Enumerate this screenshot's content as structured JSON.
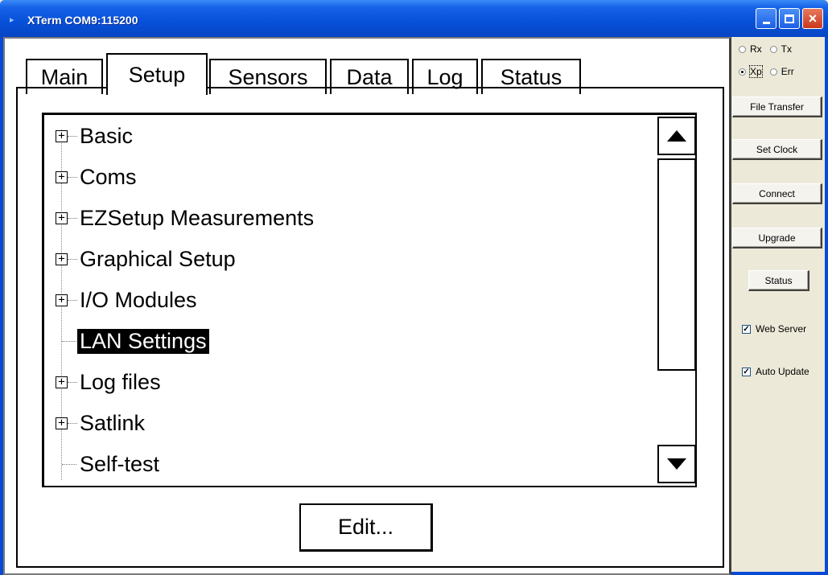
{
  "window": {
    "title": "XTerm COM9:115200"
  },
  "tabs": [
    {
      "label": "Main"
    },
    {
      "label": "Setup"
    },
    {
      "label": "Sensors"
    },
    {
      "label": "Data"
    },
    {
      "label": "Log"
    },
    {
      "label": "Status"
    }
  ],
  "active_tab": "Setup",
  "tree": {
    "items": [
      {
        "label": "Basic",
        "expandable": true
      },
      {
        "label": "Coms",
        "expandable": true
      },
      {
        "label": "EZSetup Measurements",
        "expandable": true
      },
      {
        "label": "Graphical Setup",
        "expandable": true
      },
      {
        "label": "I/O Modules",
        "expandable": true
      },
      {
        "label": "LAN Settings",
        "expandable": false,
        "selected": true
      },
      {
        "label": "Log files",
        "expandable": true
      },
      {
        "label": "Satlink",
        "expandable": true
      },
      {
        "label": "Self-test",
        "expandable": false
      }
    ],
    "expander_glyph": "+"
  },
  "edit_button": {
    "label": "Edit..."
  },
  "side": {
    "radios": [
      {
        "label": "Rx",
        "checked": false
      },
      {
        "label": "Tx",
        "checked": false
      },
      {
        "label": "Xp",
        "checked": true
      },
      {
        "label": "Err",
        "checked": false
      }
    ],
    "buttons": {
      "file_transfer": "File Transfer",
      "set_clock": "Set Clock",
      "connect": "Connect",
      "upgrade": "Upgrade",
      "status": "Status"
    },
    "checkboxes": {
      "web_server": {
        "label": "Web Server",
        "checked": true
      },
      "auto_update": {
        "label": "Auto Update",
        "checked": true
      }
    }
  },
  "colors": {
    "titlebar": "#0750D8",
    "selection_bg": "#000000",
    "panel_bg": "#ECE9D8"
  }
}
